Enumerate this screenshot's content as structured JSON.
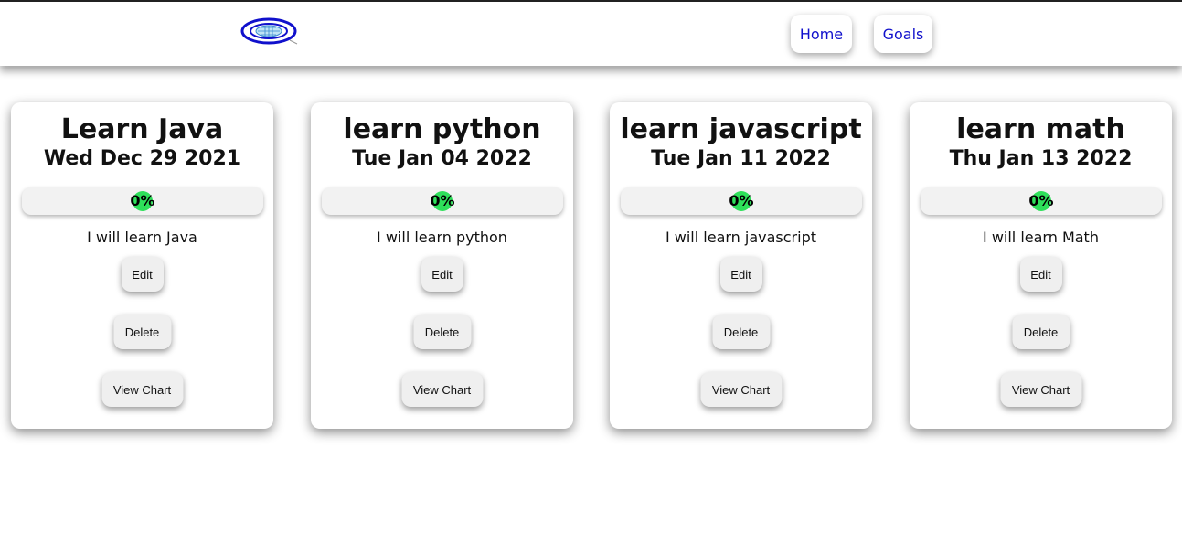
{
  "nav": {
    "home_label": "Home",
    "goals_label": "Goals",
    "link_color": "#1111cc"
  },
  "logo": {
    "icon": "planet-logo-icon"
  },
  "progress_color": "#2ee05a",
  "goals": [
    {
      "title": "Learn Java",
      "date": "Wed Dec 29 2021",
      "progress": 0,
      "progress_label": "0%",
      "description": "I will learn Java",
      "edit_label": "Edit",
      "delete_label": "Delete",
      "chart_label": "View Chart"
    },
    {
      "title": "learn python",
      "date": "Tue Jan 04 2022",
      "progress": 0,
      "progress_label": "0%",
      "description": "I will learn python",
      "edit_label": "Edit",
      "delete_label": "Delete",
      "chart_label": "View Chart"
    },
    {
      "title": "learn javascript",
      "date": "Tue Jan 11 2022",
      "progress": 0,
      "progress_label": "0%",
      "description": "I will learn javascript",
      "edit_label": "Edit",
      "delete_label": "Delete",
      "chart_label": "View Chart"
    },
    {
      "title": "learn math",
      "date": "Thu Jan 13 2022",
      "progress": 0,
      "progress_label": "0%",
      "description": "I will learn Math",
      "edit_label": "Edit",
      "delete_label": "Delete",
      "chart_label": "View Chart"
    }
  ]
}
